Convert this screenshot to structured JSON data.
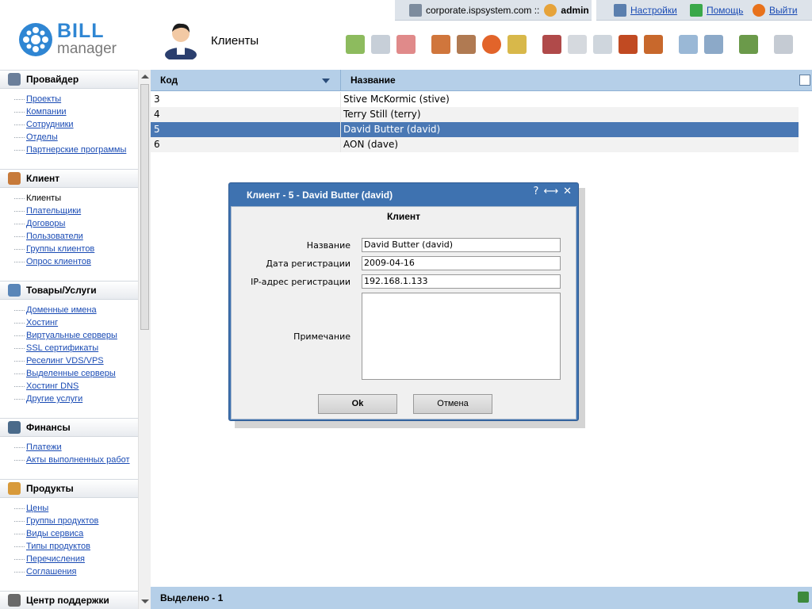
{
  "topbar": {
    "server": "corporate.ispsystem.com ::",
    "user": "admin",
    "settings": "Настройки",
    "help": "Помощь",
    "logout": "Выйти"
  },
  "logo": {
    "line1": "BILL",
    "line2": "manager"
  },
  "page": {
    "title": "Клиенты"
  },
  "sidebar": [
    {
      "title": "Провайдер",
      "items": [
        "Проекты",
        "Компании",
        "Сотрудники",
        "Отделы",
        "Партнерские программы"
      ]
    },
    {
      "title": "Клиент",
      "items": [
        "Клиенты",
        "Плательщики",
        "Договоры",
        "Пользователи",
        "Группы клиентов",
        "Опрос клиентов"
      ]
    },
    {
      "title": "Товары/Услуги",
      "items": [
        "Доменные имена",
        "Хостинг",
        "Виртуальные серверы",
        "SSL сертификаты",
        "Реселинг VDS/VPS",
        "Выделенные серверы",
        "Хостинг DNS",
        "Другие услуги"
      ]
    },
    {
      "title": "Финансы",
      "items": [
        "Платежи",
        "Акты выполненных работ"
      ]
    },
    {
      "title": "Продукты",
      "items": [
        "Цены",
        "Группы продуктов",
        "Виды сервиса",
        "Типы продуктов",
        "Перечисления",
        "Соглашения"
      ]
    },
    {
      "title": "Центр поддержки",
      "items": []
    }
  ],
  "grid": {
    "columns": [
      "Код",
      "Название"
    ],
    "rows": [
      {
        "id": "3",
        "name": "Stive McKormic (stive)"
      },
      {
        "id": "4",
        "name": "Terry Still (terry)"
      },
      {
        "id": "5",
        "name": "David Butter (david)"
      },
      {
        "id": "6",
        "name": "AON (dave)"
      }
    ],
    "selected_index": 2,
    "footer": "Выделено - 1"
  },
  "dialog": {
    "title": "Клиент - 5 - David Butter (david)",
    "controls": [
      "?",
      "⟷",
      "✕"
    ],
    "section": "Клиент",
    "fields": {
      "name_label": "Название",
      "name_value": "David Butter (david)",
      "date_label": "Дата регистрации",
      "date_value": "2009-04-16",
      "ip_label": "IP-адрес регистрации",
      "ip_value": "192.168.1.133",
      "note_label": "Примечание",
      "note_value": ""
    },
    "ok": "Ok",
    "cancel": "Отмена"
  },
  "colors": {
    "header": "#b5cfe8",
    "selected_row": "#4a78b4",
    "dialog": "#3e72b0",
    "link": "#1a4bb4"
  }
}
